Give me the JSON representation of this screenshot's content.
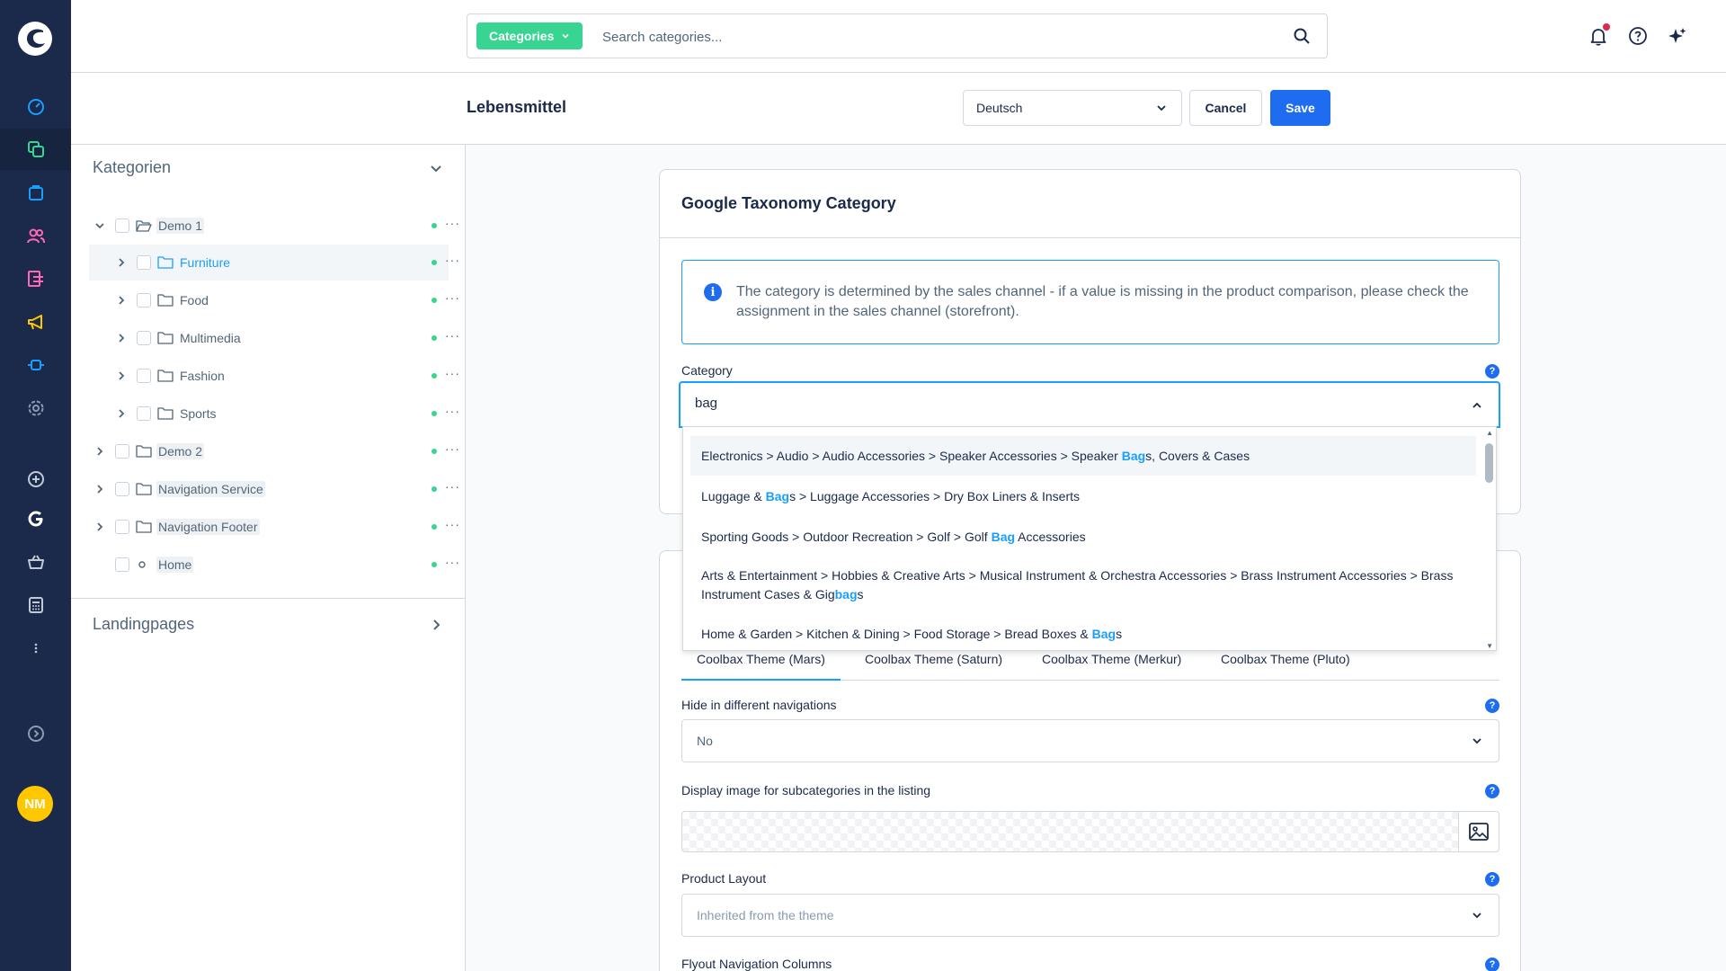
{
  "search": {
    "type_label": "Categories",
    "placeholder": "Search categories..."
  },
  "header": {
    "title": "Lebensmittel",
    "language": "Deutsch",
    "cancel_label": "Cancel",
    "save_label": "Save"
  },
  "user": {
    "initials": "NM"
  },
  "sidebar": {
    "categories_title": "Kategorien",
    "landingpages_title": "Landingpages",
    "tree": [
      {
        "label": "Demo 1",
        "level": 0,
        "expanded": true
      },
      {
        "label": "Furniture",
        "level": 1,
        "selected": true
      },
      {
        "label": "Food",
        "level": 1
      },
      {
        "label": "Multimedia",
        "level": 1
      },
      {
        "label": "Fashion",
        "level": 1
      },
      {
        "label": "Sports",
        "level": 1
      },
      {
        "label": "Demo 2",
        "level": 0
      },
      {
        "label": "Navigation Service",
        "level": 0
      },
      {
        "label": "Navigation Footer",
        "level": 0
      },
      {
        "label": "Home",
        "level": 0
      }
    ]
  },
  "taxonomy": {
    "title": "Google Taxonomy Category",
    "info": "The category is determined by the sales channel - if a value is missing in the product comparison, please check the assignment in the sales channel (storefront).",
    "category_label": "Category",
    "category_value": "bag",
    "options": [
      {
        "pre": "Electronics > Audio > Audio Accessories > Speaker Accessories > Speaker ",
        "hit": "Bag",
        "post": "s, Covers & Cases"
      },
      {
        "pre": "Luggage & ",
        "hit": "Bag",
        "post": "s > Luggage Accessories > Dry Box Liners & Inserts"
      },
      {
        "pre": "Sporting Goods > Outdoor Recreation > Golf > Golf ",
        "hit": "Bag",
        "post": " Accessories"
      },
      {
        "pre": "Arts & Entertainment > Hobbies & Creative Arts > Musical Instrument & Orchestra Accessories > Brass Instrument Accessories > Brass Instrument Cases & Gig",
        "hit": "bag",
        "post": "s"
      },
      {
        "pre": "Home & Garden > Kitchen & Dining > Food Storage > Bread Boxes & ",
        "hit": "Bag",
        "post": "s"
      }
    ]
  },
  "theme": {
    "tabs": [
      "Coolbax Theme (Mars)",
      "Coolbax Theme (Saturn)",
      "Coolbax Theme (Merkur)",
      "Coolbax Theme (Pluto)"
    ],
    "hide_label": "Hide in different navigations",
    "hide_value": "No",
    "display_image_label": "Display image for subcategories in the listing",
    "product_layout_label": "Product Layout",
    "product_layout_placeholder": "Inherited from the theme",
    "flyout_label": "Flyout Navigation Columns"
  },
  "colors": {
    "nav_bg": "#1b2a4a",
    "accent": "#189eff",
    "primary": "#1e6cf0",
    "success": "#37d492"
  }
}
